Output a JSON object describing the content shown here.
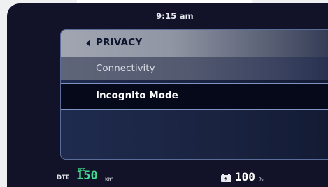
{
  "status_bar": {
    "time": "9:15 am"
  },
  "menu": {
    "title": "PRIVACY",
    "back_icon": "caret-left-icon",
    "items": [
      {
        "label": "Connectivity",
        "selected": false
      },
      {
        "label": "Incognito Mode",
        "selected": true
      }
    ]
  },
  "footer": {
    "dte_label": "DTE",
    "eco_label": "ECO",
    "range_value": "150",
    "range_unit": "km",
    "battery_icon": "battery-charging-icon",
    "battery_value": "100",
    "battery_unit": "%"
  },
  "colors": {
    "screen_background": "#121328",
    "accent_green": "#45d891",
    "selection_border": "#7f93c5"
  }
}
